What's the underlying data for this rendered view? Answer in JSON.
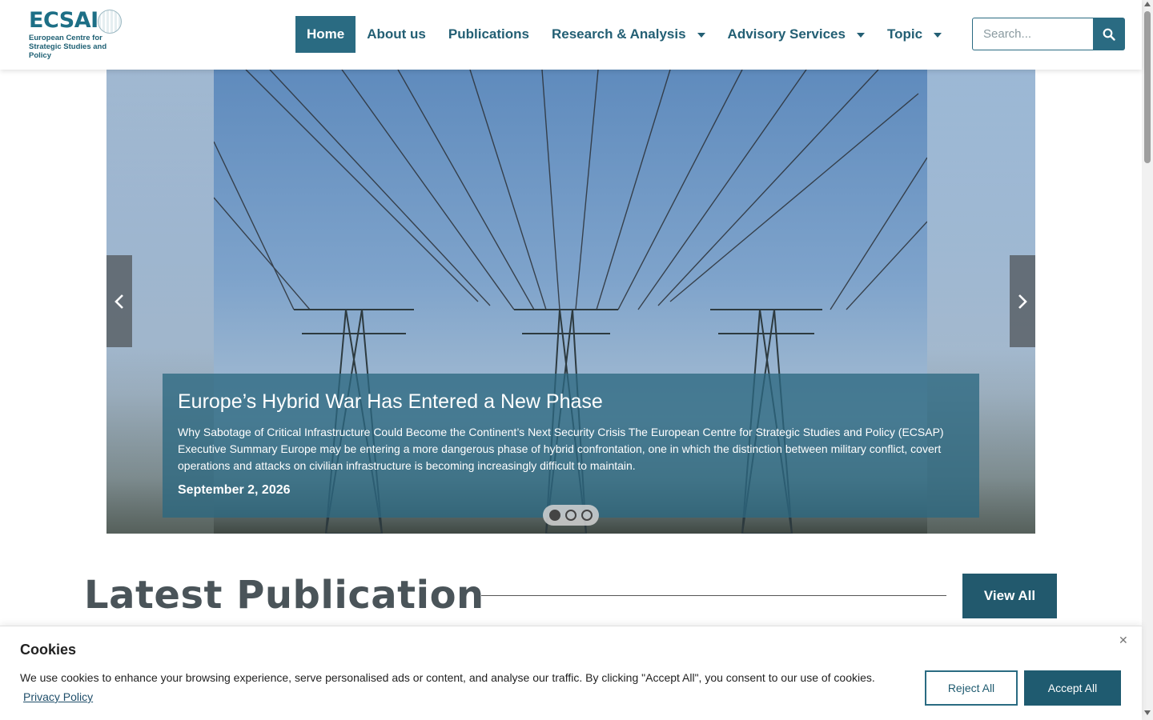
{
  "brand": {
    "logo_text": "ECSAI",
    "logo_subtitle": "European Centre for Strategic Studies and Policy"
  },
  "nav": {
    "items": [
      {
        "label": "Home",
        "active": true
      },
      {
        "label": "About us"
      },
      {
        "label": "Publications"
      },
      {
        "label": "Research & Analysis",
        "dropdown": true
      },
      {
        "label": "Advisory Services",
        "dropdown": true
      },
      {
        "label": "Topic",
        "dropdown": true
      }
    ]
  },
  "search": {
    "placeholder": "Search...",
    "button_icon": "search-icon"
  },
  "slider": {
    "title": "Europe’s Hybrid War Has Entered a New Phase",
    "excerpt": "Why Sabotage of Critical Infrastructure Could Become the Continent’s Next Security Crisis The European Centre for Strategic Studies and Policy (ECSAP) Executive Summary Europe may be entering a more dangerous phase of hybrid confrontation, one in which the distinction between military conflict, covert operations and attacks on civilian infrastructure is becoming increasingly difficult to maintain.",
    "date": "September 2, 2026",
    "slides_total": 3,
    "active_slide": 1
  },
  "latest": {
    "title": "Latest Publication",
    "view_all_label": "View All"
  },
  "cookies": {
    "title": "Cookies",
    "text": "We use cookies to enhance your browsing experience, serve personalised ads or content, and analyse our traffic. By clicking \"Accept All\", you consent to our use of cookies.",
    "privacy_link": "Privacy Policy",
    "reject_label": "Reject All",
    "accept_label": "Accept All"
  },
  "colors": {
    "brand": "#2a6b82",
    "dark": "#1f5b70",
    "heading": "#4a5459"
  }
}
